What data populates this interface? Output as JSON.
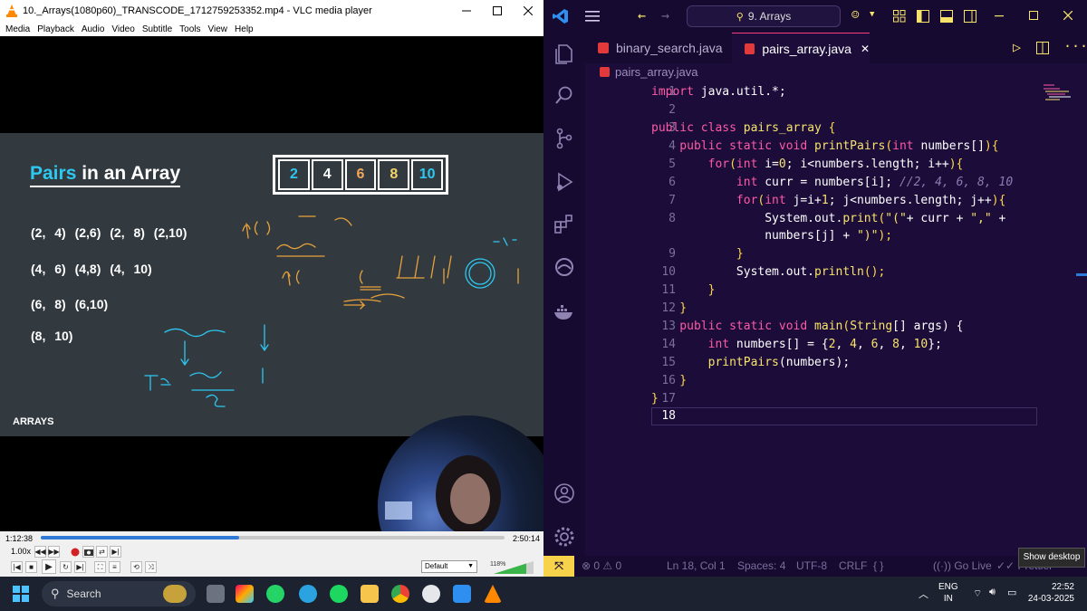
{
  "vlc": {
    "title": "10._Arrays(1080p60)_TRANSCODE_1712759253352.mp4 - VLC media player",
    "menu": [
      "Media",
      "Playback",
      "Audio",
      "Video",
      "Subtitle",
      "Tools",
      "View",
      "Help"
    ],
    "time_elapsed": "1:12:38",
    "time_total": "2:50:14",
    "progress_fraction": 0.427,
    "speed": "1.00x",
    "aspect": "Default",
    "volume_percent": "118%",
    "slide": {
      "title_accent": "Pairs",
      "title_rest": " in an Array",
      "array": [
        "2",
        "4",
        "6",
        "8",
        "10"
      ],
      "pair_rows": [
        "(2, 4)  (2,6)  (2, 8)  (2,10)",
        "(4, 6)  (4,8)  (4, 10)",
        "(6, 8)  (6,10)",
        "(8, 10)"
      ],
      "footer": "ARRAYS"
    }
  },
  "vscode": {
    "search_text": "9. Arrays",
    "tabs": [
      {
        "label": "binary_search.java",
        "active": false
      },
      {
        "label": "pairs_array.java",
        "active": true
      }
    ],
    "breadcrumb": "pairs_array.java",
    "line_numbers": [
      "1",
      "2",
      "3",
      "4",
      "5",
      "6",
      "7",
      "8",
      "",
      "9",
      "10",
      "11",
      "12",
      "13",
      "14",
      "15",
      "16",
      "17",
      "18"
    ],
    "code": {
      "l1a": "import",
      "l1b": " java.util.*;",
      "l3a": "public",
      "l3b": " class",
      "l3c": " pairs_array",
      "l3d": " {",
      "l4a": "    public",
      "l4b": " static",
      "l4c": " void",
      "l4d": " printPairs",
      "l4e": "(",
      "l4f": "int",
      "l4g": " numbers[]",
      "l4h": "){",
      "l5a": "        for",
      "l5b": "(",
      "l5c": "int",
      "l5d": " i=",
      "l5e": "0",
      "l5f": "; i<numbers.length; i++",
      "l5g": "){",
      "l6a": "            int",
      "l6b": " curr = numbers[i];",
      "l6c": " //2, 4, 6, 8, 10",
      "l7a": "            for",
      "l7b": "(",
      "l7c": "int",
      "l7d": " j=i+",
      "l7e": "1",
      "l7f": "; j<numbers.length; j++",
      "l7g": "){",
      "l8a": "                System.out.",
      "l8b": "print",
      "l8c": "(",
      "l8d": "\"(\"",
      "l8e": "+ curr + ",
      "l8f": "\",\"",
      "l8g": " +",
      "l8h": "                numbers[j] + ",
      "l8i": "\")\"",
      "l8j": ");",
      "l9a": "            }",
      "l10a": "            System.out.",
      "l10b": "println",
      "l10c": "();",
      "l11a": "        }",
      "l12a": "    }",
      "l13a": "    public",
      "l13b": " static",
      "l13c": " void",
      "l13d": " main",
      "l13e": "(",
      "l13f": "String",
      "l13g": "[] args) {",
      "l14a": "        int",
      "l14b": " numbers[] = {",
      "l14c": "2",
      "l14d": ", ",
      "l14e": "4",
      "l14f": ", ",
      "l14g": "6",
      "l14h": ", ",
      "l14i": "8",
      "l14j": ", ",
      "l14k": "10",
      "l14l": "};",
      "l15a": "        printPairs",
      "l15b": "(numbers);",
      "l16a": "    }",
      "l17a": "}"
    },
    "status": {
      "problems": "⊗ 0 ⚠ 0",
      "position": "Ln 18, Col 1",
      "spaces": "Spaces: 4",
      "encoding": "UTF-8",
      "eol": "CRLF",
      "golive": "Go Live",
      "prettier": "Prettier"
    },
    "tooltip": "Show desktop"
  },
  "taskbar": {
    "search_label": "Search",
    "lang_1": "ENG",
    "lang_2": "IN",
    "time": "22:52",
    "date": "24-03-2025"
  },
  "colors": {
    "vscode_bg": "#1b0c3a",
    "keyword": "#ff5aa6",
    "function": "#f7e36b",
    "slide_accent": "#2ec7f0",
    "slide_bg": "#323a40",
    "annotation": "#e8a23a"
  }
}
